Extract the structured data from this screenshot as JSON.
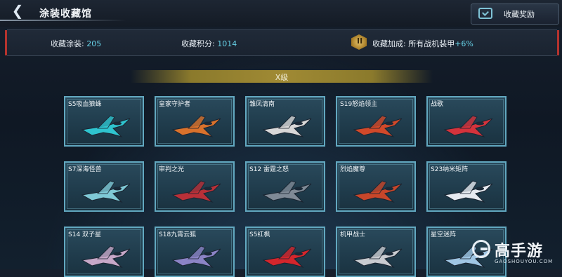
{
  "header": {
    "title": "涂装收藏馆",
    "reward_button": "收藏奖励"
  },
  "stats": {
    "collected_label": "收藏涂装:",
    "collected_value": "205",
    "points_label": "收藏积分:",
    "points_value": "1014",
    "bonus_label": "收藏加成: 所有战机装甲",
    "bonus_value": "+6%"
  },
  "section": {
    "label": "X级"
  },
  "cards": [
    {
      "label": "S5吸血狼蛛",
      "color": "#2fc4cf"
    },
    {
      "label": "皇家守护者",
      "color": "#d9722c"
    },
    {
      "label": "雏凤清南",
      "color": "#d8d8d8"
    },
    {
      "label": "S19怒焰领主",
      "color": "#d1492a"
    },
    {
      "label": "战歌",
      "color": "#d4333c"
    },
    {
      "label": "S7深海怪兽",
      "color": "#7fc9d6"
    },
    {
      "label": "审判之光",
      "color": "#b93038"
    },
    {
      "label": "S12 雷霆之怒",
      "color": "#7f8a96"
    },
    {
      "label": "烈焰魔尊",
      "color": "#c7462a"
    },
    {
      "label": "S23纳米矩阵",
      "color": "#e6eaf0"
    },
    {
      "label": "S14 双子星",
      "color": "#c7a8c8"
    },
    {
      "label": "S18九霄云狐",
      "color": "#8b84c6"
    },
    {
      "label": "S5红枫",
      "color": "#d4262c"
    },
    {
      "label": "机甲战士",
      "color": "#c9ccd1"
    },
    {
      "label": "星空迷阵",
      "color": "#9fc6e4"
    }
  ],
  "watermark": {
    "text": "高手游",
    "sub": "GAOSHOUYOU.COM"
  }
}
